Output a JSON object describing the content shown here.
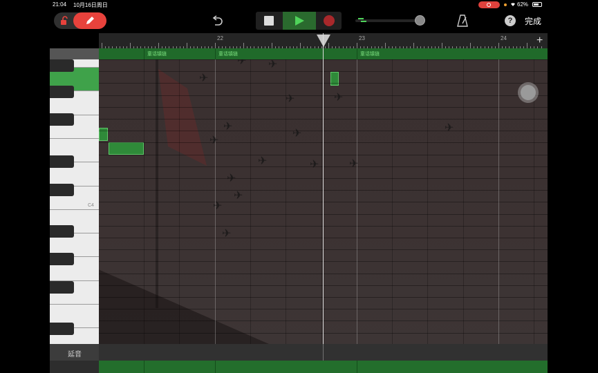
{
  "status_bar": {
    "time": "21:04",
    "date": "10月16日周日",
    "wifi_icon": "wifi-icon",
    "battery_percent": "62%"
  },
  "toolbar": {
    "done_label": "完成",
    "help_label": "?",
    "undo_icon": "undo-icon",
    "metronome_icon": "metronome-icon"
  },
  "ruler": {
    "bars": [
      "22",
      "23",
      "24"
    ],
    "add_label": "+"
  },
  "regions": [
    {
      "label": "童话镇链"
    },
    {
      "label": "童话镇链"
    },
    {
      "label": "童话镇链"
    }
  ],
  "keyboard": {
    "c4_label": "C4"
  },
  "sustain": {
    "label": "延音"
  },
  "colors": {
    "accent_green": "#2f8a39",
    "record_red": "#e8423c",
    "play_green": "#4fd45a"
  }
}
